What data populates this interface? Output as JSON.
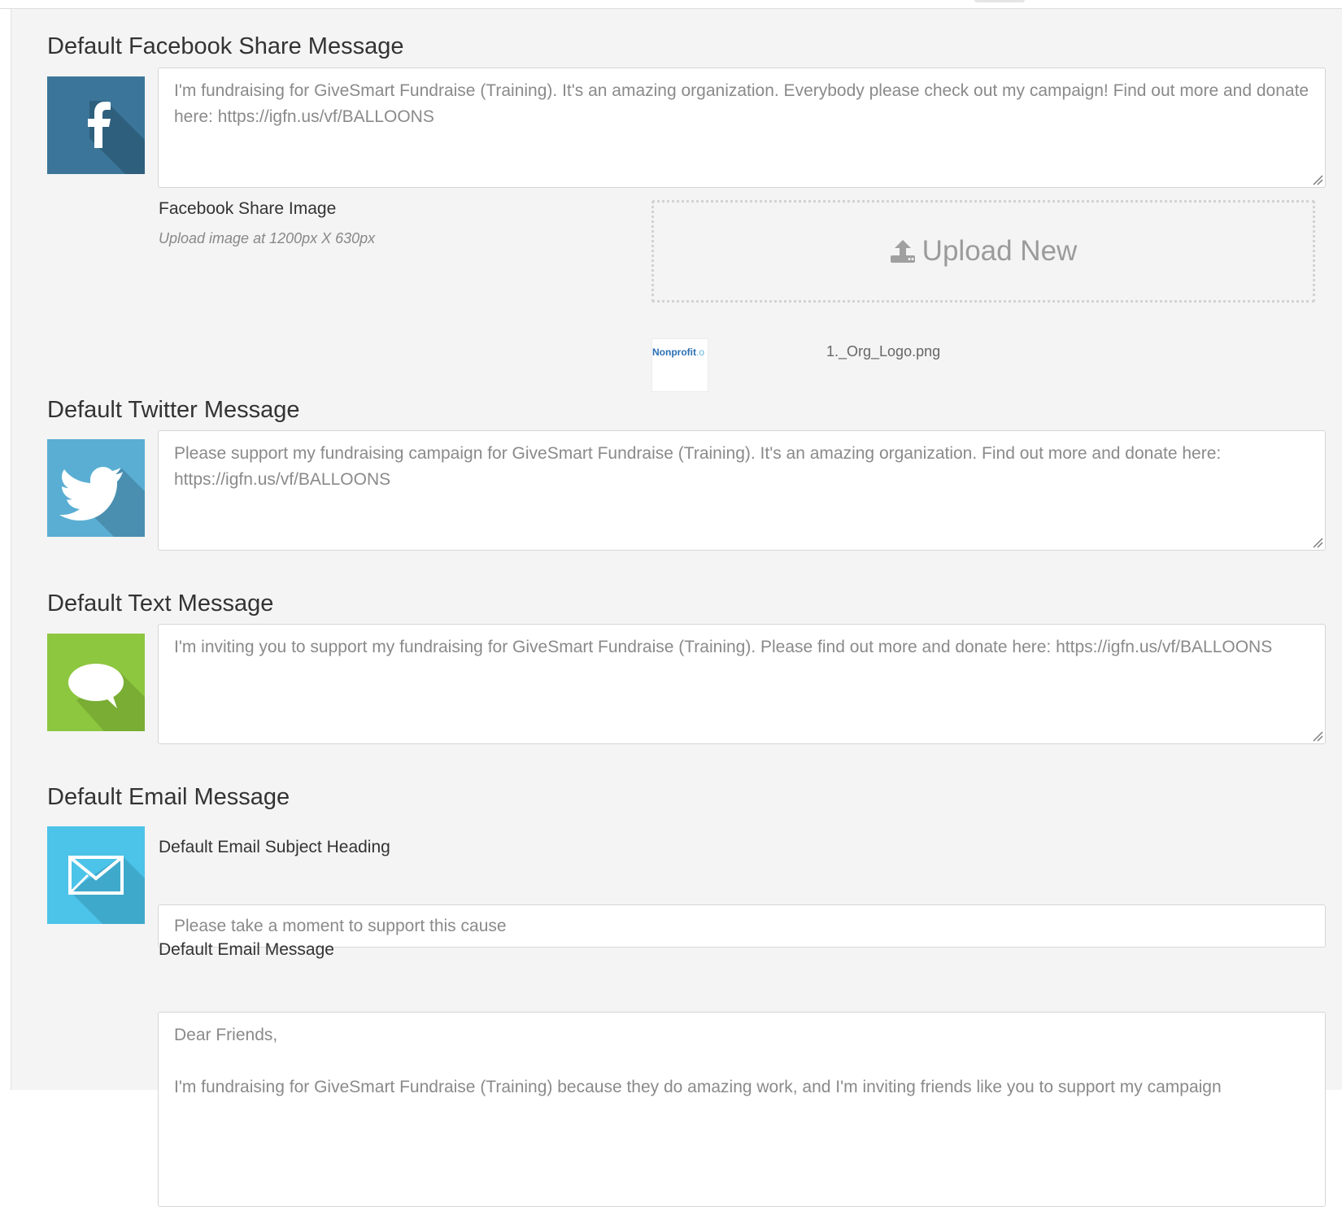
{
  "facebook": {
    "heading": "Default Facebook Share Message",
    "message": "I'm fundraising for GiveSmart Fundraise (Training). It's an amazing organization. Everybody please check out my campaign! Find out more and donate here: https://igfn.us/vf/BALLOONS",
    "image_label": "Facebook Share Image",
    "image_hint": "Upload image at 1200px X 630px",
    "upload_label": "Upload New",
    "thumbnail_text": "Nonprofit",
    "thumbnail_suffix": ".o",
    "file_name": "1._Org_Logo.png",
    "color": "#3b7599"
  },
  "twitter": {
    "heading": "Default Twitter Message",
    "message": "Please support my fundraising campaign for GiveSmart Fundraise (Training). It's an amazing organization. Find out more and donate here: https://igfn.us/vf/BALLOONS",
    "color": "#5aaed3"
  },
  "text": {
    "heading": "Default Text Message",
    "message": "I'm inviting you to support my fundraising for GiveSmart Fundraise (Training). Please find out more and donate here: https://igfn.us/vf/BALLOONS",
    "color": "#8dc63f"
  },
  "email": {
    "heading": "Default Email Message",
    "subject_label": "Default Email Subject Heading",
    "subject_value": "Please take a moment to support this cause",
    "message_label": "Default Email Message",
    "message_line1": "Dear Friends,",
    "message_line2": "I'm fundraising for GiveSmart Fundraise (Training) because they do amazing work, and I'm inviting friends like you to support my campaign",
    "color": "#4cc3e8"
  }
}
